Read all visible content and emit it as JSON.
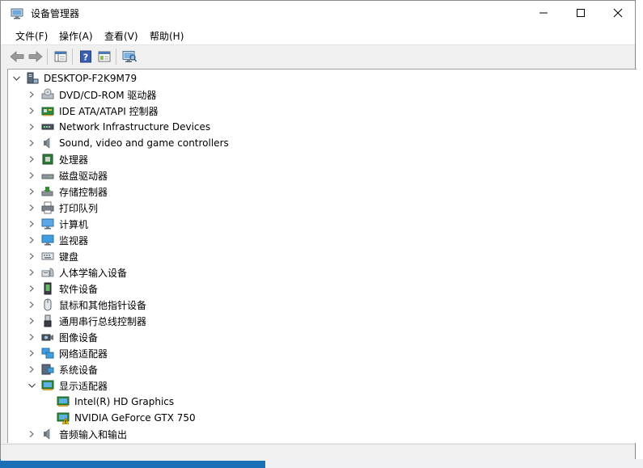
{
  "window": {
    "title": "设备管理器"
  },
  "menu": [
    "文件(F)",
    "操作(A)",
    "查看(V)",
    "帮助(H)"
  ],
  "tree": {
    "root": "DESKTOP-F2K9M79",
    "categories": [
      {
        "label": "DVD/CD-ROM 驱动器",
        "icon": "dvd-drive-icon"
      },
      {
        "label": "IDE ATA/ATAPI 控制器",
        "icon": "ide-controller-icon"
      },
      {
        "label": "Network Infrastructure Devices",
        "icon": "network-infrastructure-icon"
      },
      {
        "label": "Sound, video and game controllers",
        "icon": "speaker-icon"
      },
      {
        "label": "处理器",
        "icon": "processor-icon"
      },
      {
        "label": "磁盘驱动器",
        "icon": "disk-drive-icon"
      },
      {
        "label": "存储控制器",
        "icon": "storage-controller-icon"
      },
      {
        "label": "打印队列",
        "icon": "printer-icon"
      },
      {
        "label": "计算机",
        "icon": "computer-icon"
      },
      {
        "label": "监视器",
        "icon": "monitor-icon"
      },
      {
        "label": "键盘",
        "icon": "keyboard-icon"
      },
      {
        "label": "人体学输入设备",
        "icon": "hid-icon"
      },
      {
        "label": "软件设备",
        "icon": "software-device-icon"
      },
      {
        "label": "鼠标和其他指针设备",
        "icon": "mouse-icon"
      },
      {
        "label": "通用串行总线控制器",
        "icon": "usb-icon"
      },
      {
        "label": "图像设备",
        "icon": "camera-icon"
      },
      {
        "label": "网络适配器",
        "icon": "network-adapter-icon"
      },
      {
        "label": "系统设备",
        "icon": "system-device-icon"
      },
      {
        "label": "显示适配器",
        "icon": "display-adapter-icon",
        "expanded": true,
        "children": [
          {
            "label": "Intel(R) HD Graphics",
            "icon": "display-adapter-icon"
          },
          {
            "label": "NVIDIA GeForce GTX 750",
            "icon": "display-adapter-warning-icon"
          }
        ]
      },
      {
        "label": "音频输入和输出",
        "icon": "speaker-icon"
      }
    ]
  }
}
